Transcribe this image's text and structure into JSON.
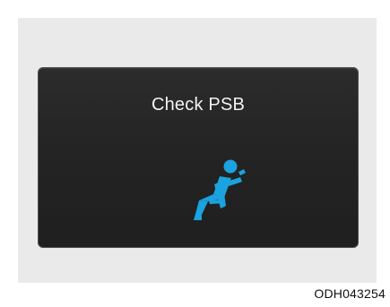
{
  "display": {
    "message": "Check PSB",
    "icon": "seatbelt-warning-icon",
    "icon_color": "#1aa3de",
    "background_color": "#242424",
    "text_color": "#f2f2f2"
  },
  "figure": {
    "code": "ODH043254"
  }
}
